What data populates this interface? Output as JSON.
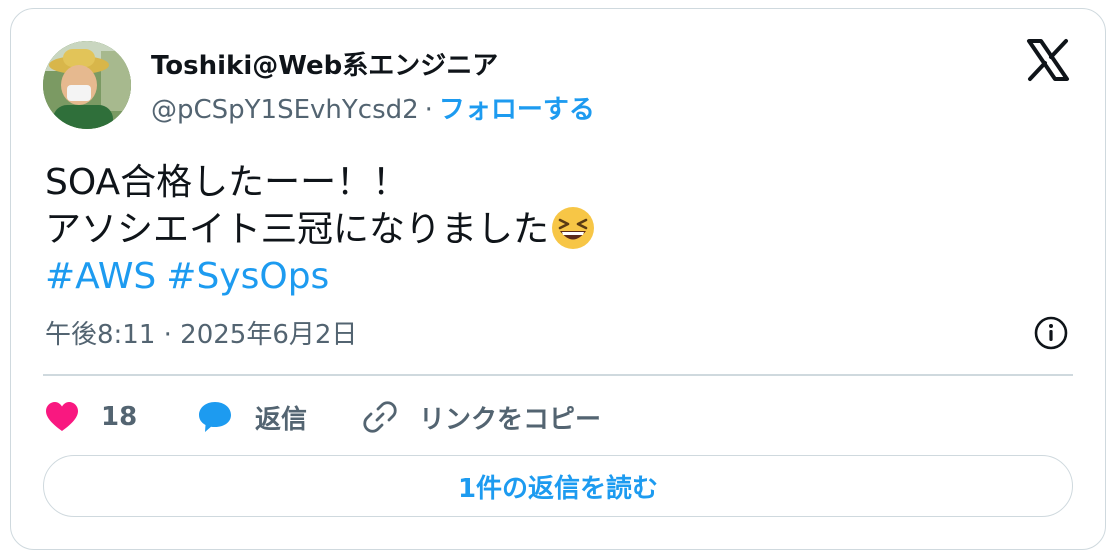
{
  "author": {
    "display_name": "Toshiki@Web系エンジニア",
    "handle": "@pCSpY1SEvhYcsd2",
    "separator": "·",
    "follow_label": "フォローする"
  },
  "tweet": {
    "line1": "SOA合格したーー！！",
    "line2": "アソシエイト三冠になりました",
    "emoji": "grinning-squinting-face-icon",
    "hashtags": [
      "#AWS",
      "#SysOps"
    ],
    "timestamp": "午後8:11 · 2025年6月2日"
  },
  "actions": {
    "like_count": "18",
    "reply_label": "返信",
    "copy_link_label": "リンクをコピー"
  },
  "read_replies_label": "1件の返信を読む",
  "colors": {
    "accent": "#1d9bf0",
    "heart": "#f91880",
    "secondary_text": "#536471",
    "border": "#cfd9de"
  },
  "icons": [
    "x-logo-icon",
    "info-icon",
    "heart-icon",
    "reply-bubble-icon",
    "link-icon"
  ]
}
